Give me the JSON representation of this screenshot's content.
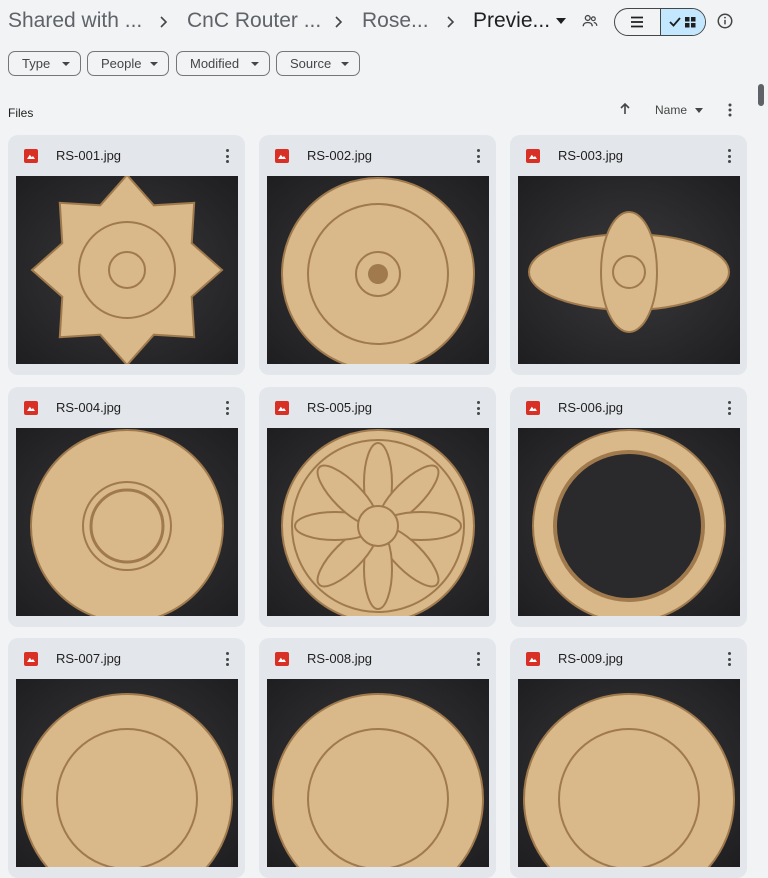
{
  "breadcrumb": {
    "items": [
      "Shared with ...",
      "CnC Router ...",
      "Rose...",
      "Previe..."
    ]
  },
  "filters": [
    "Type",
    "People",
    "Modified",
    "Source"
  ],
  "section": {
    "label": "Files"
  },
  "sort": {
    "label": "Name"
  },
  "files": [
    {
      "name": "RS-001.jpg",
      "style": "star"
    },
    {
      "name": "RS-002.jpg",
      "style": "round"
    },
    {
      "name": "RS-003.jpg",
      "style": "oval"
    },
    {
      "name": "RS-004.jpg",
      "style": "ring"
    },
    {
      "name": "RS-005.jpg",
      "style": "flower"
    },
    {
      "name": "RS-006.jpg",
      "style": "frame"
    },
    {
      "name": "RS-007.jpg",
      "style": "round-top"
    },
    {
      "name": "RS-008.jpg",
      "style": "round-top"
    },
    {
      "name": "RS-009.jpg",
      "style": "round-top"
    }
  ],
  "colors": {
    "accent": "#c2e7ff",
    "file_icon": "#d93025",
    "wood": "#d9b88a",
    "wood_dark": "#a07a4c"
  }
}
